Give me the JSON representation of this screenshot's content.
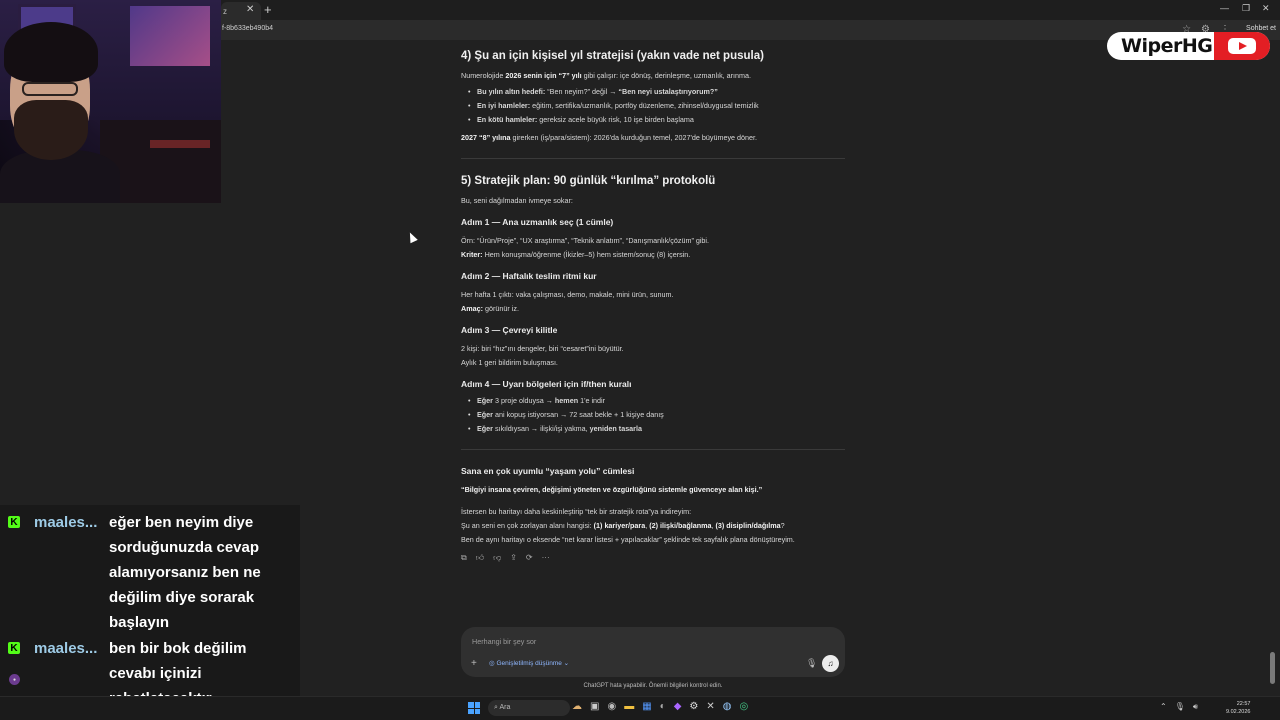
{
  "browser": {
    "tab_title": "z",
    "url_fragment": "f-8b633eb490b4",
    "profile_label": "Sohbet et"
  },
  "logo": {
    "text": "WiperHG"
  },
  "article": {
    "s4_title": "4) Şu an için kişisel yıl stratejisi (yakın vade net pusula)",
    "s4_intro_pre": "Numerolojide ",
    "s4_intro_bold": "2026 senin için “7” yılı",
    "s4_intro_post": " gibi çalışır: içe dönüş, derinleşme, uzmanlık, arınma.",
    "s4_b1_bold": "Bu yılın altın hedefi:",
    "s4_b1_text": " “Ben neyim?” değil → ",
    "s4_b1_bold2": "“Ben neyi ustalaştırıyorum?”",
    "s4_b2_bold": "En iyi hamleler:",
    "s4_b2_text": " eğitim, sertifika/uzmanlık, portföy düzenleme, zihinsel/duygusal temizlik",
    "s4_b3_bold": "En kötü hamleler:",
    "s4_b3_text": " gereksiz acele büyük risk, 10 işe birden başlama",
    "s4_outro_bold": "2027 “8” yılına",
    "s4_outro_text": " girerken (iş/para/sistem): 2026'da kurduğun temel, 2027'de büyümeye döner.",
    "s5_title": "5) Stratejik plan: 90 günlük “kırılma” protokolü",
    "s5_intro": "Bu, seni dağılmadan ivmeye sokar:",
    "step1_title": "Adım 1 — Ana uzmanlık seç (1 cümle)",
    "step1_p1": "Örn: “Ürün/Proje”, “UX araştırma”, “Teknik anlatım”, “Danışmanlık/çözüm” gibi.",
    "step1_p2_bold": "Kriter:",
    "step1_p2_text": " Hem konuşma/öğrenme (İkizler–5) hem sistem/sonuç (8) içersin.",
    "step2_title": "Adım 2 — Haftalık teslim ritmi kur",
    "step2_p1": "Her hafta 1 çıktı: vaka çalışması, demo, makale, mini ürün, sunum.",
    "step2_p2_bold": "Amaç:",
    "step2_p2_text": " görünür iz.",
    "step3_title": "Adım 3 — Çevreyi kilitle",
    "step3_p1": "2 kişi: biri “hız”ını dengeler, biri “cesaret”ini büyütür.",
    "step3_p2": "Aylık 1 geri bildirim buluşması.",
    "step4_title": "Adım 4 — Uyarı bölgeleri için if/then kuralı",
    "step4_b1_bold": "Eğer",
    "step4_b1_text": " 3 proje olduysa → ",
    "step4_b1_bold2": "hemen",
    "step4_b1_text2": " 1'e indir",
    "step4_b2_bold": "Eğer",
    "step4_b2_text": " ani kopuş istiyorsan → 72 saat bekle + 1 kişiye danış",
    "step4_b3_bold": "Eğer",
    "step4_b3_text": " sıkıldıysan → ilişki/işi yakma, ",
    "step4_b3_bold2": "yeniden tasarla",
    "s6_title": "Sana en çok uyumlu “yaşam yolu” cümlesi",
    "s6_quote": "“Bilgiyi insana çeviren, değişimi yöneten ve özgürlüğünü sistemle güvenceye alan kişi.”",
    "s6_p1": "İstersen bu haritayı daha keskinleştirip “tek bir stratejik rota”ya indireyim:",
    "s6_p2_text": "Şu an seni en çok zorlayan alanı hangisi: ",
    "s6_p2_bold": "(1) kariyer/para",
    "s6_p2_sep1": ", ",
    "s6_p2_bold2": "(2) ilişki/bağlanma",
    "s6_p2_sep2": ", ",
    "s6_p2_bold3": "(3) disiplin/dağılma",
    "s6_p2_end": "?",
    "s6_p3": "Ben de aynı haritayı o eksende “net karar listesi + yapılacaklar” şeklinde tek sayfalık plana dönüştüreyim."
  },
  "composer": {
    "placeholder": "Herhangi bir şey sor",
    "mode_label": "Genişletilmiş düşünme",
    "disclaimer": "ChatGPT hata yapabilir. Önemli bilgileri kontrol edin."
  },
  "chat": {
    "messages": [
      {
        "user": "maales...",
        "text": "eğer ben neyim diye sorduğunuzda cevap alamıyorsanız ben ne değilim diye sorarak başlayın"
      },
      {
        "user": "maales...",
        "text": "ben bir bok değilim cevabı içinizi rahatlatacaktır"
      }
    ],
    "badge": "K",
    "brand_color": "#53fc18"
  },
  "taskbar": {
    "search_label": "Ara",
    "time": "22:57",
    "date": "9.02.2026"
  },
  "icons": [
    "search-icon",
    "copy-icon",
    "thumbs-up-icon",
    "thumbs-down-icon",
    "share-icon",
    "regenerate-icon",
    "more-icon",
    "plus-icon",
    "mic-icon",
    "voice-icon"
  ]
}
